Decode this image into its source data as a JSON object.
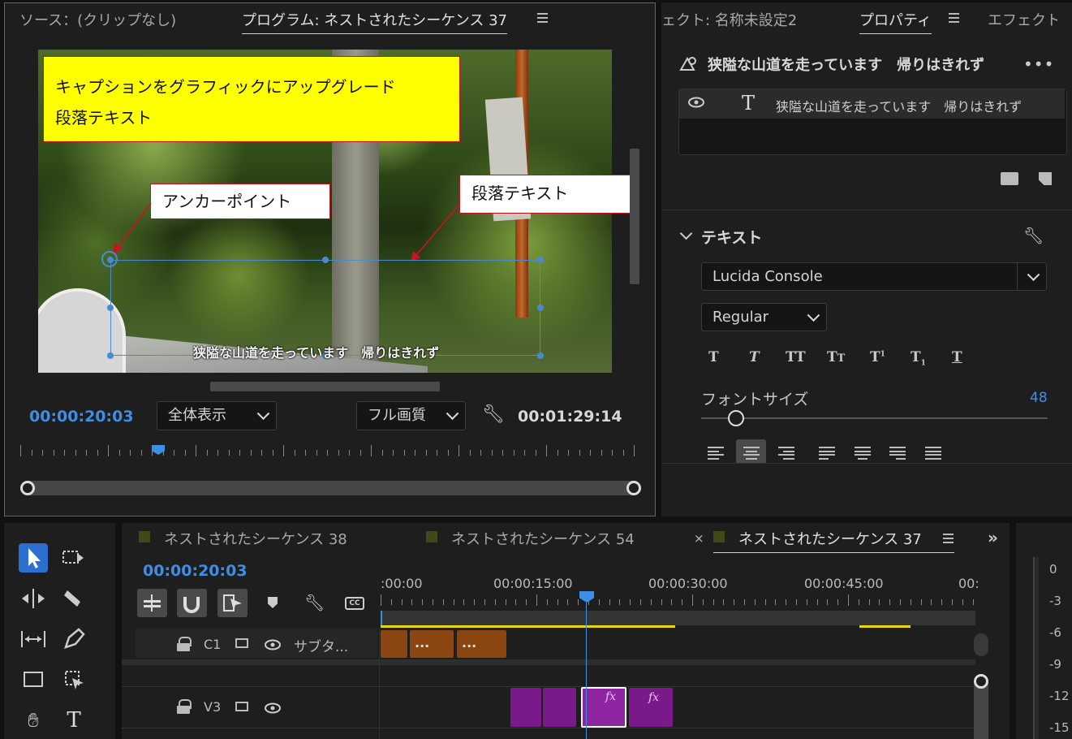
{
  "program_monitor": {
    "tab_source": "ソース：(クリップなし)",
    "tab_program": "プログラム: ネストされたシーケンス 37",
    "menu_icon": "hamburger-icon",
    "annotation_title_line1": "キャプションをグラフィックにアップグレード",
    "annotation_title_line2": "段落テキスト",
    "annotation_anchor": "アンカーポイント",
    "annotation_paragraph": "段落テキスト",
    "subtitle_text": "狭隘な山道を走っています　帰りはきれず",
    "current_time": "00:00:20:03",
    "zoom_select": "全体表示",
    "quality_select": "フル画質",
    "duration": "00:01:29:14",
    "colors": {
      "highlight": "#ffff00",
      "annotation_border": "#c4101c",
      "accent": "#3d8fe6"
    }
  },
  "properties_panel": {
    "tab_effects": "ェクト: 名称未設定2",
    "tab_properties": "プロパティ",
    "tab_fx": "エフェクト",
    "layer_title": "狭隘な山道を走っています　帰りはきれず",
    "more_icon": "more-icon",
    "layer_name": "狭隘な山道を走っています　帰りはきれず",
    "section_text": "テキスト",
    "font_family": "Lucida Console",
    "font_style": "Regular",
    "font_size_label": "フォントサイズ",
    "font_size_value": "48",
    "font_size_fraction": 0.1
  },
  "timeline": {
    "tabs": [
      {
        "label": "ネストされたシーケンス 38"
      },
      {
        "label": "ネストされたシーケンス 54"
      },
      {
        "label": "ネストされたシーケンス 37"
      }
    ],
    "close_symbol": "×",
    "current_time": "00:00:20:03",
    "ruler": [
      ":00:00",
      "00:00:15:00",
      "00:00:30:00",
      "00:00:45:00",
      "00:"
    ],
    "track_c1_label": "C1",
    "track_c1_name": "サブタ...",
    "track_v3_label": "V3",
    "caption_clip_text": "...",
    "fx_label": "fx",
    "clip_colors": {
      "caption": "#8a4510",
      "video": "#7a1a8a"
    }
  },
  "audio_meter": {
    "labels": [
      "0",
      "-3",
      "-6",
      "-9",
      "-12",
      "-15"
    ]
  }
}
